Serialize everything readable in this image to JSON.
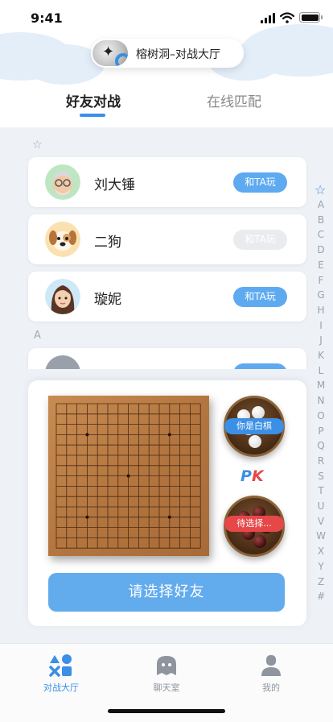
{
  "status_bar": {
    "time": "9:41"
  },
  "header": {
    "title": "榕树洞–对战大厅",
    "tabs": [
      {
        "label": "好友对战",
        "active": true
      },
      {
        "label": "在线匹配",
        "active": false
      }
    ]
  },
  "list": {
    "sections": [
      {
        "header_icon": "star-icon"
      },
      {
        "header": "A"
      }
    ],
    "friends": [
      {
        "name": "刘大锤",
        "avatar": "old-man-avatar",
        "button": "和TA玩",
        "enabled": true
      },
      {
        "name": "二狗",
        "avatar": "dog-avatar",
        "button": "和TA玩",
        "enabled": false
      },
      {
        "name": "璇妮",
        "avatar": "girl-avatar",
        "button": "和TA玩",
        "enabled": true
      }
    ]
  },
  "index_bar": {
    "star": "☆",
    "letters": [
      "A",
      "B",
      "C",
      "D",
      "E",
      "F",
      "G",
      "H",
      "I",
      "J",
      "K",
      "L",
      "M",
      "N",
      "O",
      "P",
      "Q",
      "R",
      "S",
      "T",
      "U",
      "V",
      "W",
      "X",
      "Y",
      "Z",
      "#"
    ]
  },
  "game_panel": {
    "player_tag": "你是白棋",
    "opponent_tag": "待选择...",
    "pk_p": "P",
    "pk_k": "K",
    "select_button": "请选择好友"
  },
  "bottom_nav": {
    "items": [
      {
        "label": "对战大厅",
        "icon": "game-shapes-icon",
        "active": true
      },
      {
        "label": "聊天室",
        "icon": "chat-bubble-icon",
        "active": false
      },
      {
        "label": "我的",
        "icon": "user-icon",
        "active": false
      }
    ]
  },
  "colors": {
    "accent": "#3b8fe4",
    "button_blue": "#62abed",
    "red_tag": "#e6484a",
    "disabled": "#e9ebee",
    "background": "#eef1f6"
  }
}
